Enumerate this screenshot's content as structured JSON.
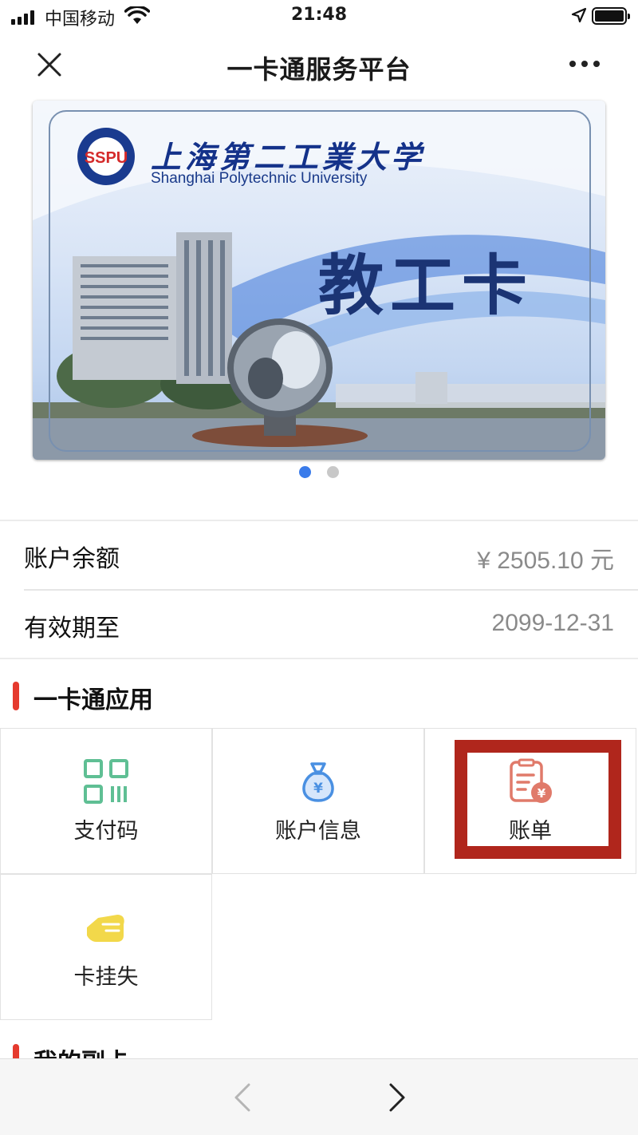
{
  "status_bar": {
    "carrier": "中国移动",
    "time": "21:48"
  },
  "nav": {
    "title": "一卡通服务平台",
    "close_icon": "close-icon",
    "more_icon": "more-dots-icon"
  },
  "carousel": {
    "cards": [
      {
        "school_name_cn": "上海第二工業大学",
        "school_name_en": "Shanghai Polytechnic University",
        "logo_text": "SSPU",
        "card_type": "教工卡"
      }
    ],
    "dots": [
      {
        "active": true,
        "color": "#3a7bea"
      },
      {
        "active": false,
        "color": "#c8c8c8"
      }
    ]
  },
  "account": {
    "balance_label": "账户余额",
    "balance_value": "¥ 2505.10 元",
    "expiry_label": "有效期至",
    "expiry_value": "2099-12-31"
  },
  "apps_section": {
    "title": "一卡通应用",
    "accent_color": "#e53a2e",
    "items": [
      {
        "label": "支付码",
        "icon": "qr-code-icon",
        "color": "#5fbf94"
      },
      {
        "label": "账户信息",
        "icon": "money-bag-icon",
        "color": "#4a90e2"
      },
      {
        "label": "账单",
        "icon": "bill-icon",
        "color": "#e07a6a",
        "highlighted": true
      },
      {
        "label": "卡挂失",
        "icon": "card-lost-icon",
        "color": "#f2d84a"
      }
    ]
  },
  "sub_card_section": {
    "title": "我的副卡"
  },
  "toolbar": {
    "back_icon": "chevron-left-icon",
    "forward_icon": "chevron-right-icon"
  }
}
